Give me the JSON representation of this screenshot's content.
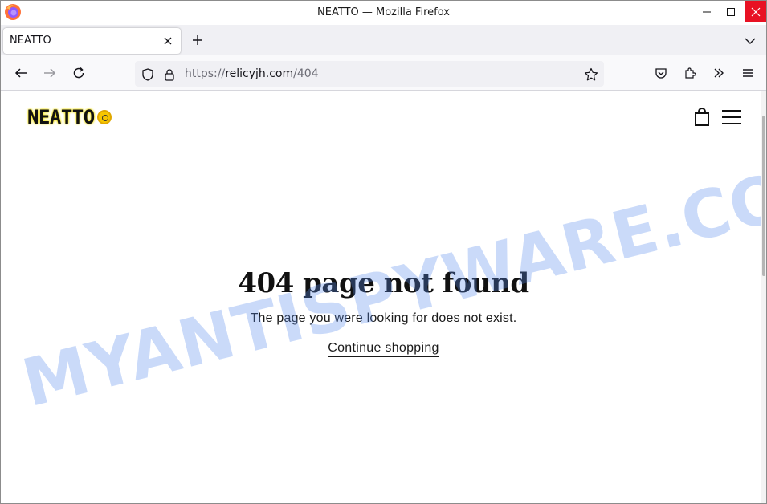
{
  "window": {
    "title": "NEATTO — Mozilla Firefox"
  },
  "tabs": [
    {
      "label": "NEATTO",
      "active": true
    }
  ],
  "urlbar": {
    "scheme": "https://",
    "host": "relicyjh.com",
    "path": "/404"
  },
  "site": {
    "logo_text": "NEATTO",
    "heading": "404 page not found",
    "message": "The page you were looking for does not exist.",
    "continue_label": "Continue shopping"
  },
  "watermark": {
    "text": "MYANTISPYWARE.COM"
  },
  "colors": {
    "close_button": "#e81123",
    "tabstrip_bg": "#f0f0f4",
    "watermark": "#5a8ceb"
  }
}
